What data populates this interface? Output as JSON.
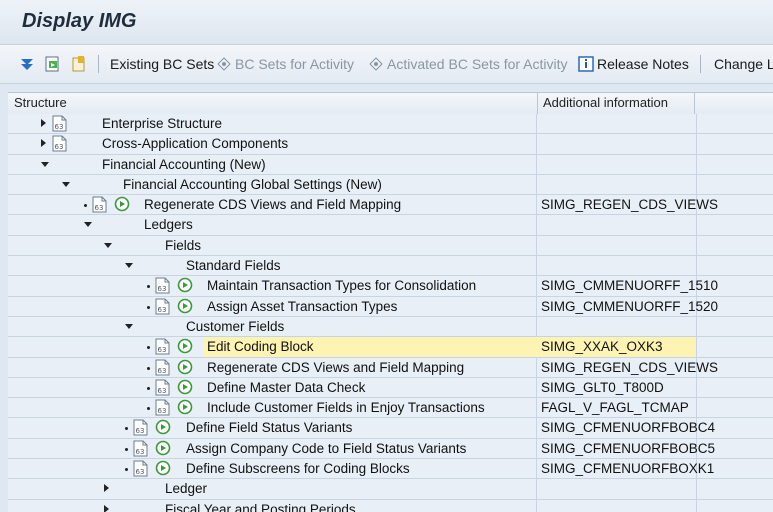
{
  "window": {
    "title": "Display IMG"
  },
  "toolbar": {
    "existing_bc_sets": "Existing BC Sets",
    "bc_sets_for_activity": "BC Sets for Activity",
    "activated_bc_sets": "Activated BC Sets for Activity",
    "release_notes": "Release Notes",
    "change_log": "Change Lo"
  },
  "columns": {
    "structure": "Structure",
    "additional": "Additional information"
  },
  "rows": [
    {
      "label": "Enterprise Structure",
      "info": ""
    },
    {
      "label": "Cross-Application Components",
      "info": ""
    },
    {
      "label": "Financial Accounting (New)",
      "info": ""
    },
    {
      "label": "Financial Accounting Global Settings (New)",
      "info": ""
    },
    {
      "label": "Regenerate CDS Views and Field Mapping",
      "info": "SIMG_REGEN_CDS_VIEWS"
    },
    {
      "label": "Ledgers",
      "info": ""
    },
    {
      "label": "Fields",
      "info": ""
    },
    {
      "label": "Standard Fields",
      "info": ""
    },
    {
      "label": "Maintain Transaction Types for Consolidation",
      "info": "SIMG_CMMENUORFF_1510"
    },
    {
      "label": "Assign Asset Transaction Types",
      "info": "SIMG_CMMENUORFF_1520"
    },
    {
      "label": "Customer Fields",
      "info": ""
    },
    {
      "label": "Edit Coding Block",
      "info": "SIMG_XXAK_OXK3"
    },
    {
      "label": "Regenerate CDS Views and Field Mapping",
      "info": "SIMG_REGEN_CDS_VIEWS"
    },
    {
      "label": "Define Master Data Check",
      "info": "SIMG_GLT0_T800D"
    },
    {
      "label": "Include Customer Fields in Enjoy Transactions",
      "info": "FAGL_V_FAGL_TCMAP"
    },
    {
      "label": "Define Field Status Variants",
      "info": "SIMG_CFMENUORFBOBC4"
    },
    {
      "label": "Assign Company Code to Field Status Variants",
      "info": "SIMG_CFMENUORFBOBC5"
    },
    {
      "label": "Define Subscreens for Coding Blocks",
      "info": "SIMG_CFMENUORFBOXK1"
    },
    {
      "label": "Ledger",
      "info": ""
    },
    {
      "label": "Fiscal Year and Posting Periods",
      "info": ""
    }
  ],
  "colors": {
    "highlight": "#fdf4b3",
    "execute_green": "#3a9a3a",
    "info_blue": "#1c5fb8"
  }
}
